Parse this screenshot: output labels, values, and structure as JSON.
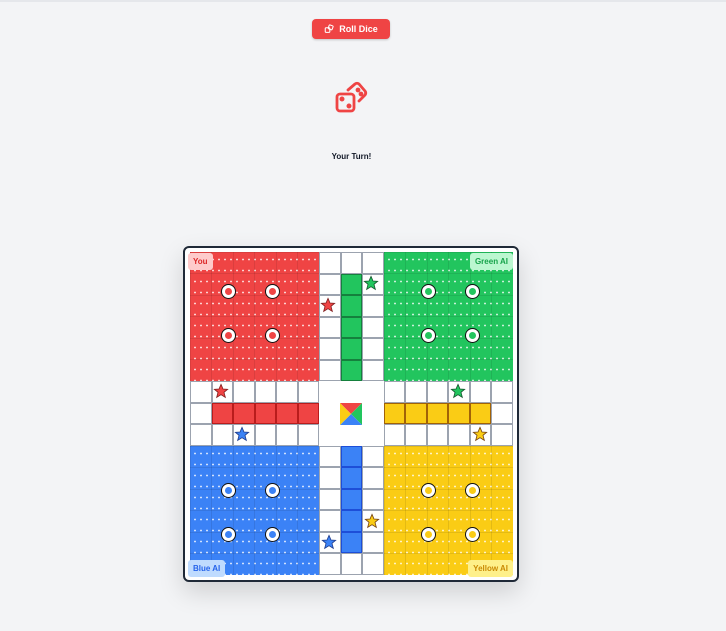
{
  "controls": {
    "roll_label": "Roll Dice"
  },
  "status": {
    "message": "Your Turn!"
  },
  "players": {
    "red": {
      "label": "You",
      "color": "#ef4444"
    },
    "green": {
      "label": "Green AI",
      "color": "#22c55e"
    },
    "blue": {
      "label": "Blue AI",
      "color": "#3b82f6"
    },
    "yellow": {
      "label": "Yellow AI",
      "color": "#facc15"
    }
  },
  "icons": {
    "roll_button_icon": "dice-icon",
    "dice_display": "dice-icon",
    "safe_square": "star-icon"
  }
}
